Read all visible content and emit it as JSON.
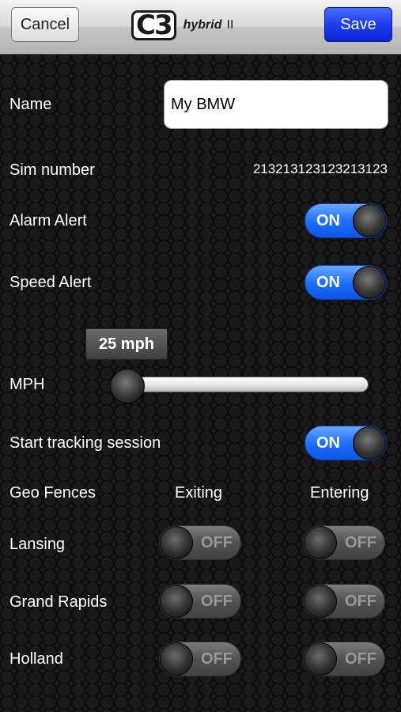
{
  "nav": {
    "cancel_label": "Cancel",
    "save_label": "Save"
  },
  "logo": {
    "mark": "C3",
    "sub": "hybrid",
    "version": "II"
  },
  "form": {
    "name_label": "Name",
    "name_value": "My BMW",
    "sim_label": "Sim number",
    "sim_value": "213213123123213123",
    "alarm_label": "Alarm Alert",
    "alarm_state": "ON",
    "speed_label": "Speed Alert",
    "speed_state": "ON",
    "mph_label": "MPH",
    "mph_value": "25 mph",
    "mph_level": 0,
    "tracking_label": "Start tracking session",
    "tracking_state": "ON"
  },
  "geofences": {
    "header": "Geo Fences",
    "col_exiting": "Exiting",
    "col_entering": "Entering",
    "items": [
      {
        "name": "Lansing",
        "exiting": "OFF",
        "entering": "OFF"
      },
      {
        "name": "Grand Rapids",
        "exiting": "OFF",
        "entering": "OFF"
      },
      {
        "name": "Holland",
        "exiting": "OFF",
        "entering": "OFF"
      }
    ]
  },
  "colors": {
    "accent_blue": "#1f6fff",
    "save_blue": "#1b3cf0"
  }
}
